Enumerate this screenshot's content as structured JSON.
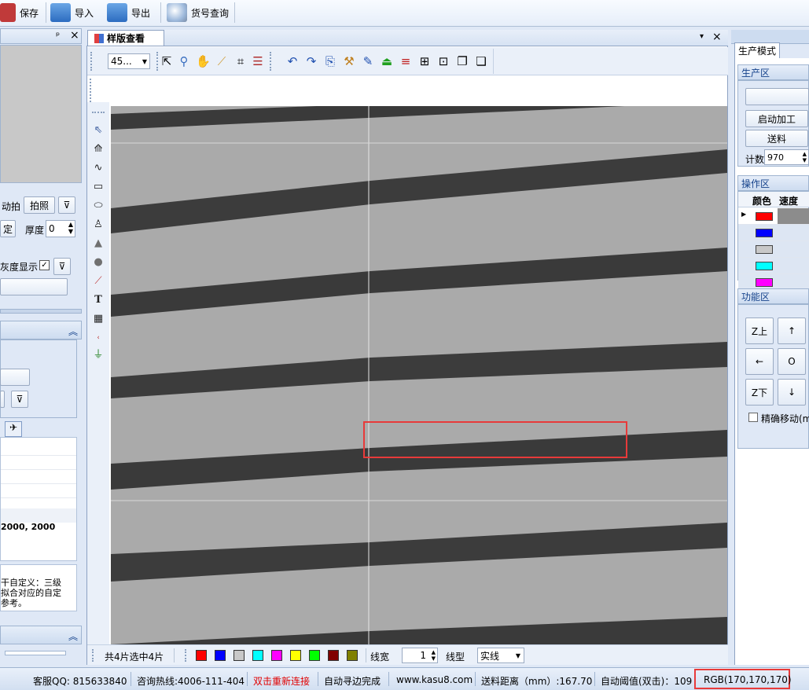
{
  "toolbar": {
    "save": "保存",
    "import": "导入",
    "export": "导出",
    "lookup": "货号查询"
  },
  "left_panel": {
    "pin": "ᵖ",
    "close": "×",
    "auto_shoot": "动拍",
    "shoot_button": "拍照",
    "set_button": "定",
    "thickness_label": "厚度",
    "thickness_value": "0",
    "gray_display": "灰度显示",
    "size_text": "2000, 2000",
    "note_text": "干自定义：三级\n拟合对应的自定\n参考。"
  },
  "document": {
    "tab_title": "样版查看",
    "zoom_value": "45...",
    "close": "×",
    "dropdown": "▾"
  },
  "bottom_bar": {
    "selection_info": "共4片选中4片",
    "swatches": [
      "#ff0000",
      "#0000ff",
      "#c8c8c8",
      "#00ffff",
      "#ff00ff",
      "#ffff00",
      "#00ff00",
      "#800000",
      "#808000"
    ],
    "line_width_label": "线宽",
    "line_width_value": "1",
    "line_type_label": "线型",
    "line_type_value": "实线"
  },
  "right_panel": {
    "mode_tab": "生产模式",
    "production_header": "生产区",
    "start_button": "启动加工",
    "feed_button": "送料",
    "count_label": "计数",
    "count_value": "970",
    "operation_header": "操作区",
    "col_color": "颜色",
    "col_speed": "速度",
    "color_rows": [
      "#ff0000",
      "#0000ff",
      "#c8c8c8",
      "#00ffff",
      "#ff00ff"
    ],
    "function_header": "功能区",
    "z_up": "Z上",
    "up": "↑",
    "left": "←",
    "origin": "O",
    "z_down": "Z下",
    "down": "↓",
    "precise_move": "精确移动(m"
  },
  "status": {
    "qq": "客服QQ: 815633840",
    "hotline": "咨询热线:4006-111-404",
    "reconnect": "双击重新连接",
    "auto_edge": "自动寻边完成",
    "website": "www.kasu8.com",
    "feed_distance": "送料距离（mm）:167.70",
    "auto_threshold": "自动阈值(双击)：109",
    "rgb": "RGB(170,170,170)"
  },
  "colors": {
    "accent": "#15428b",
    "highlight": "#e83a3a",
    "reconnect": "#e00000"
  }
}
